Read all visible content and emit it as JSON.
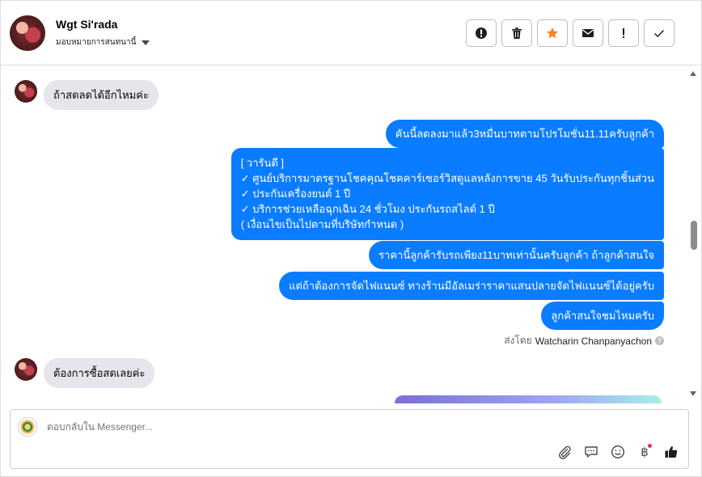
{
  "header": {
    "contact_name": "Wgt Si'rada",
    "assign_label": "มอบหมายการสนทนานี้"
  },
  "actions": [
    {
      "name": "report-spam-button",
      "icon": "alert-circle-icon"
    },
    {
      "name": "delete-button",
      "icon": "trash-icon"
    },
    {
      "name": "star-button",
      "icon": "star-icon"
    },
    {
      "name": "mark-unread-button",
      "icon": "envelope-icon"
    },
    {
      "name": "important-button",
      "icon": "exclamation-icon"
    },
    {
      "name": "mark-done-button",
      "icon": "check-icon"
    }
  ],
  "messages": {
    "in_1": "ถ้าสดลดได้อีกไหมค่ะ",
    "out_1": "คันนี้ลดลงมาแล้ว3หมื่นบาทตามโปรโมชั่น11.11ครับลูกค้า",
    "out_2_lines": [
      "[ วารันตี ]",
      "✓ ศูนย์บริการมาตรฐานโชคคุณโชคคาร์เซอร์วิสดูแลหลังการขาย 45 วันรับประกันทุกชิ้นส่วน",
      "✓ ประกันเครื่องยนต์ 1 ปี",
      "✓ บริการช่วยเหลือฉุกเฉิน 24 ชั่วโมง ประกันรถสไลด์ 1 ปี",
      "( เงื่อนไขเป็นไปตามที่บริษัทกำหนด )"
    ],
    "out_3": "ราคานี้ลูกค้ารับรถเพียง11บาทเท่านั้นครับลูกค้า ถ้าลูกค้าสนใจ",
    "out_4": "แต่ถ้าต้องการจัดไฟแนนซ์ ทางร้านมีอัลเมร่าราคาแสนปลายจัดไฟแนนซ์ได้อยู่ครับ",
    "out_5": "ลูกค้าสนใจชมไหมครับ",
    "in_2": "ต้องการซื้อสดเลยค่ะ"
  },
  "sent_by": {
    "prefix": "ส่งโดย",
    "name": "Watcharin Chanpanyachon"
  },
  "composer": {
    "placeholder": "ตอบกลับใน Messenger..."
  },
  "colors": {
    "outgoing_bubble": "#0a7cff",
    "incoming_bubble": "#e4e6eb",
    "star": "#f5821f"
  }
}
